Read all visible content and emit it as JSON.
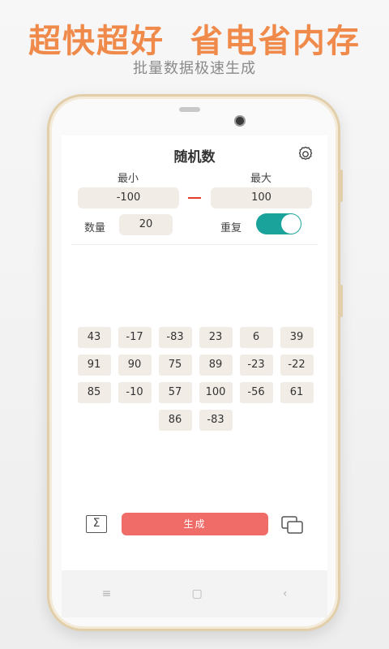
{
  "banner": {
    "headline": "超快超好  省电省内存",
    "subline": "批量数据极速生成"
  },
  "app": {
    "title": "随机数",
    "min_label": "最小",
    "max_label": "最大",
    "min_value": "-100",
    "max_value": "100",
    "count_label": "数量",
    "count_value": "20",
    "repeat_label": "重复",
    "repeat_enabled": true,
    "results": [
      "43",
      "-17",
      "-83",
      "23",
      "6",
      "39",
      "91",
      "90",
      "75",
      "89",
      "-23",
      "-22",
      "85",
      "-10",
      "57",
      "100",
      "-56",
      "61",
      "86",
      "-83"
    ],
    "sum_symbol": "Σ",
    "generate_label": "生成"
  },
  "navbar": {
    "menu_icon": "≡",
    "home_icon": "▢",
    "back_icon": "‹"
  },
  "colors": {
    "headline": "#f08a4b",
    "accent_toggle": "#1aa39a",
    "generate_button": "#ef6c69",
    "dash": "#e23b2e"
  }
}
